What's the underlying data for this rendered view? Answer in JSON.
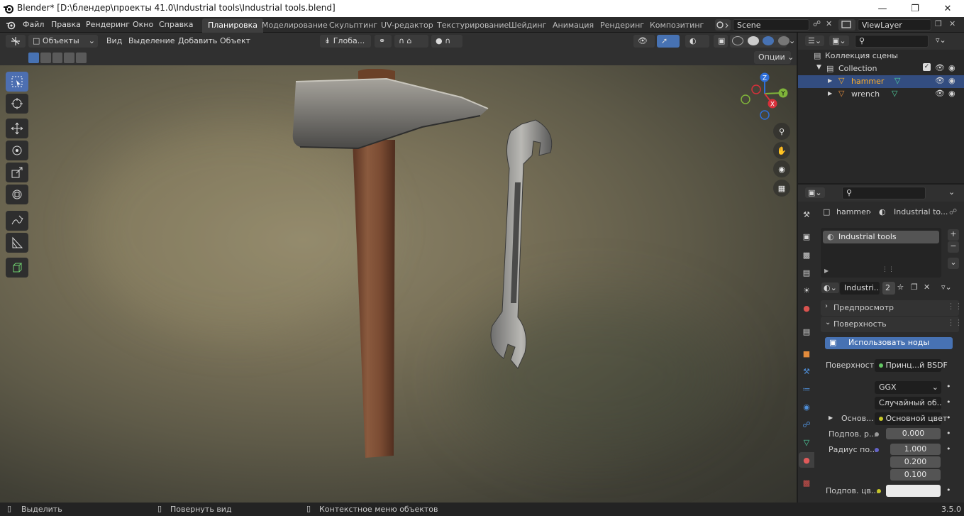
{
  "titlebar": {
    "title": "Blender* [D:\\блендер\\проекты 41.0\\Industrial tools\\Industrial tools.blend]"
  },
  "menu": [
    "Файл",
    "Правка",
    "Рендеринг",
    "Окно",
    "Справка"
  ],
  "workspaces": [
    "Планировка",
    "Моделирование",
    "Скульптинг",
    "UV-редактор",
    "Текстурирование",
    "Шейдинг",
    "Анимация",
    "Рендеринг",
    "Композитинг"
  ],
  "scene": {
    "name": "Scene",
    "view_layer": "ViewLayer"
  },
  "viewport_header": {
    "mode": "Объекты",
    "menus": [
      "Вид",
      "Выделение",
      "Добавить",
      "Объект"
    ],
    "orientation": "Глоба...",
    "options": "Опции"
  },
  "gizmo": {
    "z": "Z",
    "y": "Y",
    "x": "X"
  },
  "outliner": {
    "root": "Коллекция сцены",
    "collection": "Collection",
    "items": [
      {
        "label": "hammer"
      },
      {
        "label": "wrench"
      }
    ]
  },
  "properties": {
    "breadcrumb_object": "hammer",
    "breadcrumb_material": "Industrial to...",
    "slot": "Industrial tools",
    "material_name": "Industri...",
    "users": "2",
    "sections": {
      "preview": "Предпросмотр",
      "surface": "Поверхность"
    },
    "use_nodes": "Использовать ноды",
    "surface_label": "Поверхность",
    "surface_value": "Принц...й BSDF",
    "distribution": "GGX",
    "subsurface_method": "Случайный об...",
    "base_label": "Основ...",
    "base_value": "Основной цвет",
    "subsurface_label": "Подпов. р...",
    "subsurface_value": "0.000",
    "radius_label": "Радиус по...",
    "radius_values": [
      "1.000",
      "0.200",
      "0.100"
    ],
    "subsurface_color_label": "Подпов. цв..."
  },
  "statusbar": {
    "select": "Выделить",
    "rotate": "Повернуть вид",
    "context": "Контекстное меню объектов",
    "version": "3.5.0"
  },
  "colors": {
    "accent": "#4772b3",
    "selected_row": "#334d80",
    "hammer_label": "#ffaf29"
  }
}
